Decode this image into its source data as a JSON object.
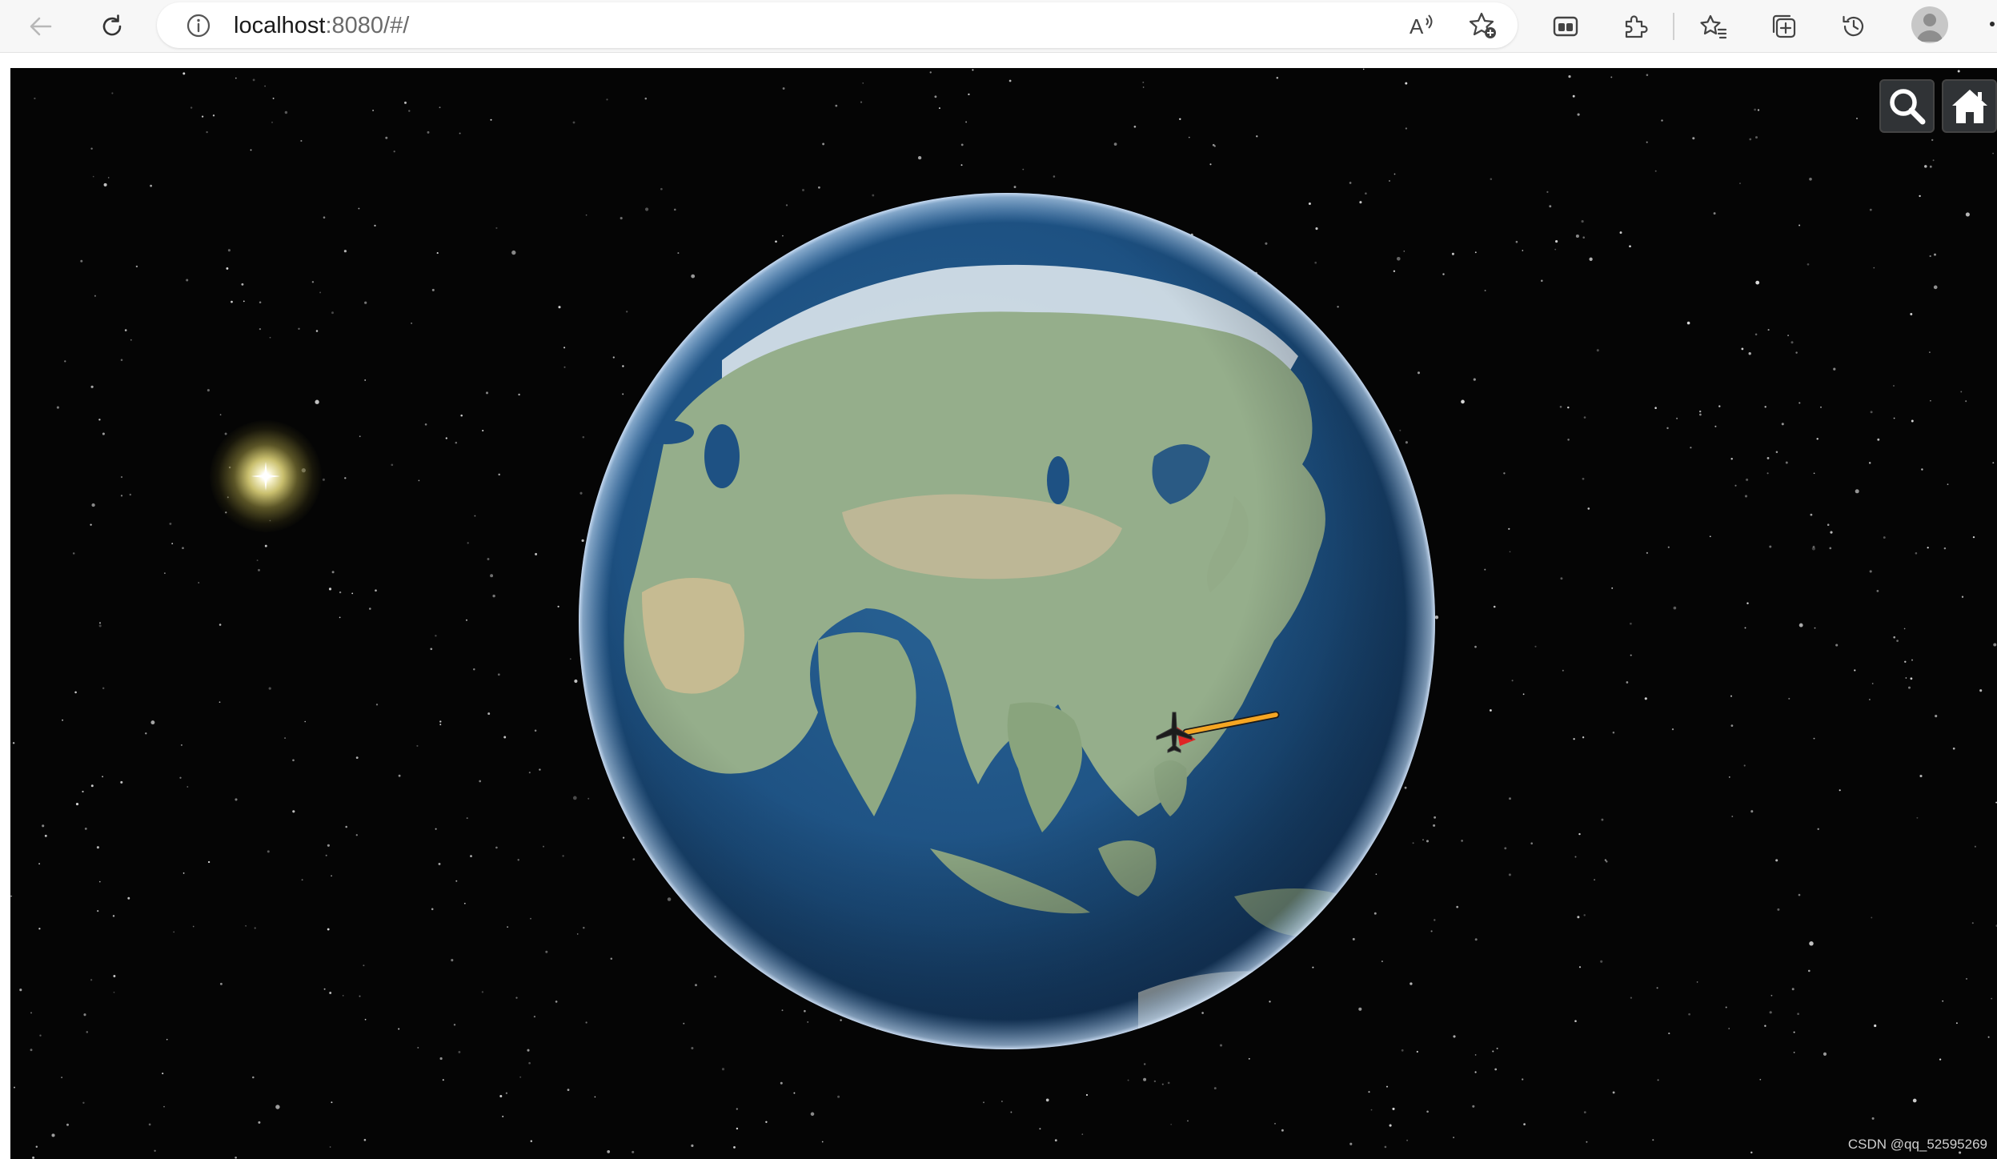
{
  "browser": {
    "url_host": "localhost",
    "url_rest": ":8080/#/",
    "icons": {
      "back": "arrow-left-icon",
      "reload": "reload-icon",
      "site_info": "info-icon",
      "read_aloud": "read-aloud-icon",
      "add_favorite": "star-plus-icon",
      "workspaces": "workspaces-icon",
      "extensions": "puzzle-icon",
      "favorites": "favorites-icon",
      "collections": "collections-icon",
      "history": "history-icon",
      "profile": "avatar-icon",
      "more": "more-icon"
    }
  },
  "viewer": {
    "toolbar": {
      "search_icon": "search-icon",
      "home_icon": "home-icon"
    },
    "scene": {
      "globe_view": "Asia",
      "marker": "airplane-icon",
      "route_color": "#f5a623",
      "marker_color": "#e02424"
    },
    "credit": "CSDN @qq_52595269"
  },
  "colors": {
    "space": "#050505",
    "ocean": "#1d4f7f",
    "land": "#93ab88",
    "desert": "#c9b98c",
    "ice": "#eef3f6"
  }
}
